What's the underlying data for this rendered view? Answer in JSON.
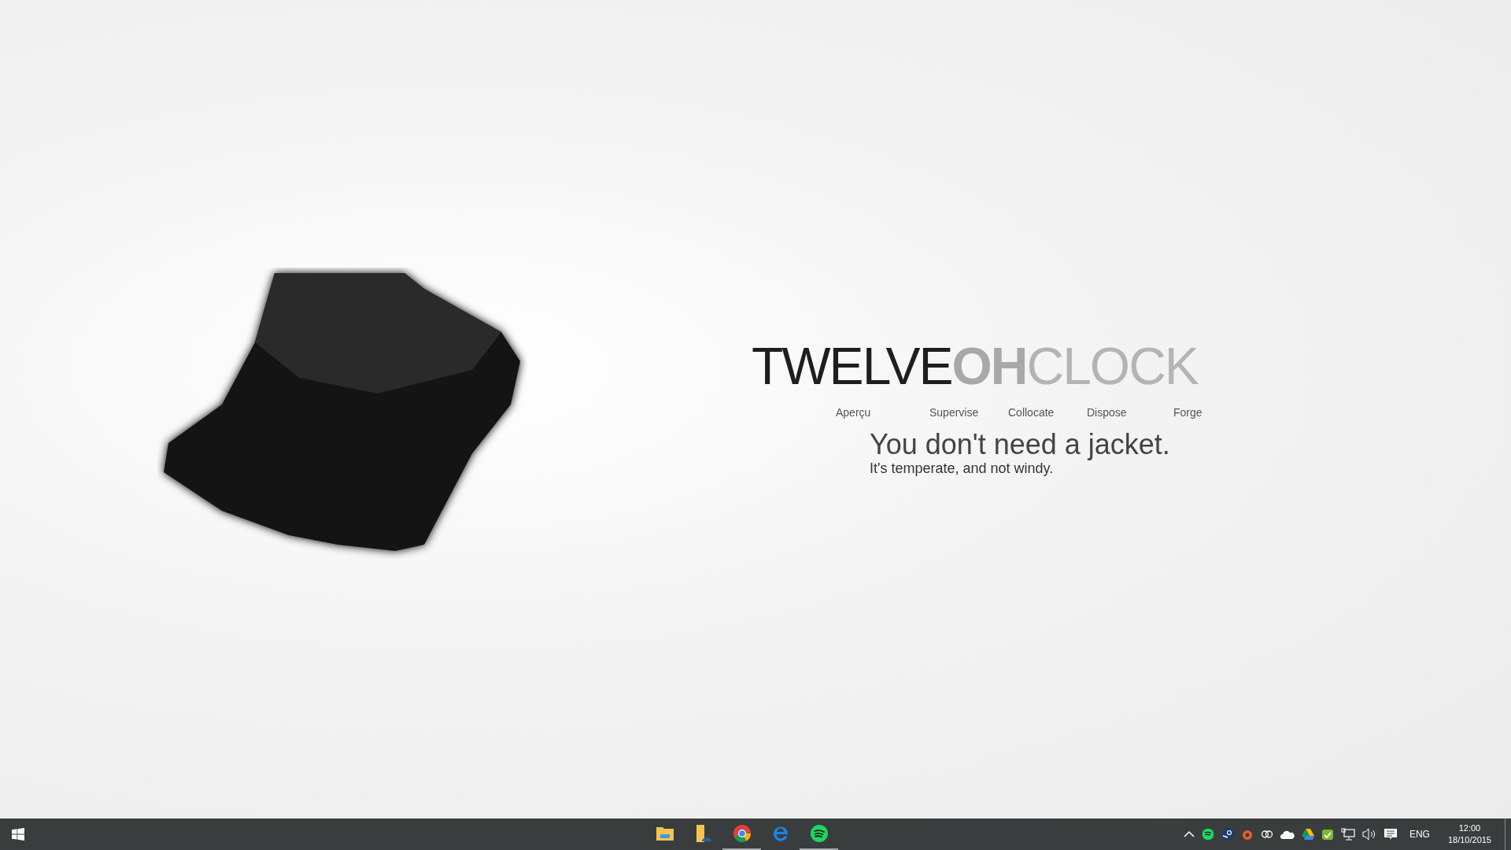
{
  "widget": {
    "title": [
      {
        "text": "TWELVE",
        "kind": "thin"
      },
      {
        "text": "OH",
        "kind": "bold"
      },
      {
        "text": "CLOCK",
        "kind": "faint"
      }
    ],
    "links": [
      "Aperçu",
      "Supervise",
      "Collocate",
      "Dispose",
      "Forge"
    ],
    "headline": "You don't need a jacket.",
    "detail": "It's temperate, and not windy."
  },
  "taskbar": {
    "apps": [
      {
        "kind": "folder",
        "running": false
      },
      {
        "kind": "documents",
        "running": false
      },
      {
        "kind": "chrome",
        "running": true
      },
      {
        "kind": "edge",
        "running": false
      },
      {
        "kind": "spotify",
        "running": true
      }
    ],
    "language": "ENG",
    "time": "12:00",
    "date": "18/10/2015"
  }
}
